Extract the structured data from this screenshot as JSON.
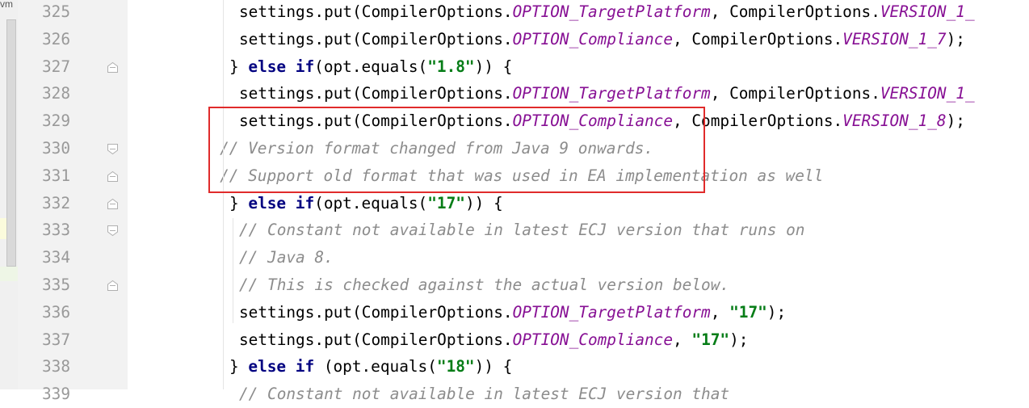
{
  "left_panel": {
    "tab_label": "vm"
  },
  "editor": {
    "lines": [
      {
        "number": "325",
        "parts": [
          {
            "t": "settings.put(CompilerOptions.",
            "c": "p"
          },
          {
            "t": "OPTION_TargetPlatform",
            "c": "f"
          },
          {
            "t": ", CompilerOptions.",
            "c": "p"
          },
          {
            "t": "VERSION_1_",
            "c": "f"
          }
        ]
      },
      {
        "number": "326",
        "parts": [
          {
            "t": "settings.put(CompilerOptions.",
            "c": "p"
          },
          {
            "t": "OPTION_Compliance",
            "c": "f"
          },
          {
            "t": ", CompilerOptions.",
            "c": "p"
          },
          {
            "t": "VERSION_1_7",
            "c": "f"
          },
          {
            "t": ");",
            "c": "p"
          }
        ]
      },
      {
        "number": "327",
        "parts": [
          {
            "t": "} ",
            "c": "p"
          },
          {
            "t": "else if",
            "c": "k"
          },
          {
            "t": "(opt.equals(",
            "c": "p"
          },
          {
            "t": "\"1.8\"",
            "c": "s"
          },
          {
            "t": ")) {",
            "c": "p"
          }
        ]
      },
      {
        "number": "328",
        "parts": [
          {
            "t": "settings.put(CompilerOptions.",
            "c": "p"
          },
          {
            "t": "OPTION_TargetPlatform",
            "c": "f"
          },
          {
            "t": ", CompilerOptions.",
            "c": "p"
          },
          {
            "t": "VERSION_1_",
            "c": "f"
          }
        ]
      },
      {
        "number": "329",
        "parts": [
          {
            "t": "settings.put(CompilerOptions.",
            "c": "p"
          },
          {
            "t": "OPTION_Compliance",
            "c": "f"
          },
          {
            "t": ", CompilerOptions.",
            "c": "p"
          },
          {
            "t": "VERSION_1_8",
            "c": "f"
          },
          {
            "t": ");",
            "c": "p"
          }
        ]
      },
      {
        "number": "330",
        "parts": [
          {
            "t": "// Version format changed from Java 9 onwards.",
            "c": "c"
          }
        ]
      },
      {
        "number": "331",
        "parts": [
          {
            "t": "// Support old format that was used in EA implementation as well",
            "c": "c"
          }
        ]
      },
      {
        "number": "332",
        "parts": [
          {
            "t": "} ",
            "c": "p"
          },
          {
            "t": "else if",
            "c": "k"
          },
          {
            "t": "(opt.equals(",
            "c": "p"
          },
          {
            "t": "\"17\"",
            "c": "s"
          },
          {
            "t": ")) {",
            "c": "p"
          }
        ]
      },
      {
        "number": "333",
        "parts": [
          {
            "t": "// Constant not available in latest ECJ version that runs on",
            "c": "c"
          }
        ]
      },
      {
        "number": "334",
        "parts": [
          {
            "t": "// Java 8.",
            "c": "c"
          }
        ]
      },
      {
        "number": "335",
        "parts": [
          {
            "t": "// This is checked against the actual version below.",
            "c": "c"
          }
        ]
      },
      {
        "number": "336",
        "parts": [
          {
            "t": "settings.put(CompilerOptions.",
            "c": "p"
          },
          {
            "t": "OPTION_TargetPlatform",
            "c": "f"
          },
          {
            "t": ", ",
            "c": "p"
          },
          {
            "t": "\"17\"",
            "c": "s"
          },
          {
            "t": ");",
            "c": "p"
          }
        ]
      },
      {
        "number": "337",
        "parts": [
          {
            "t": "settings.put(CompilerOptions.",
            "c": "p"
          },
          {
            "t": "OPTION_Compliance",
            "c": "f"
          },
          {
            "t": ", ",
            "c": "p"
          },
          {
            "t": "\"17\"",
            "c": "s"
          },
          {
            "t": ");",
            "c": "p"
          }
        ]
      },
      {
        "number": "338",
        "parts": [
          {
            "t": "} ",
            "c": "p"
          },
          {
            "t": "else if",
            "c": "k"
          },
          {
            "t": " (opt.equals(",
            "c": "p"
          },
          {
            "t": "\"18\"",
            "c": "s"
          },
          {
            "t": ")) {",
            "c": "p"
          }
        ]
      },
      {
        "number": "339",
        "parts": [
          {
            "t": "// Constant not available in latest ECJ version that",
            "c": "c"
          }
        ]
      }
    ]
  },
  "colors": {
    "keyword": "#000080",
    "string": "#067d17",
    "field": "#871094",
    "comment": "#8c8c8c",
    "highlight_box": "#e02b2b"
  },
  "icons": [
    "fold-open-icon",
    "fold-close-icon"
  ]
}
